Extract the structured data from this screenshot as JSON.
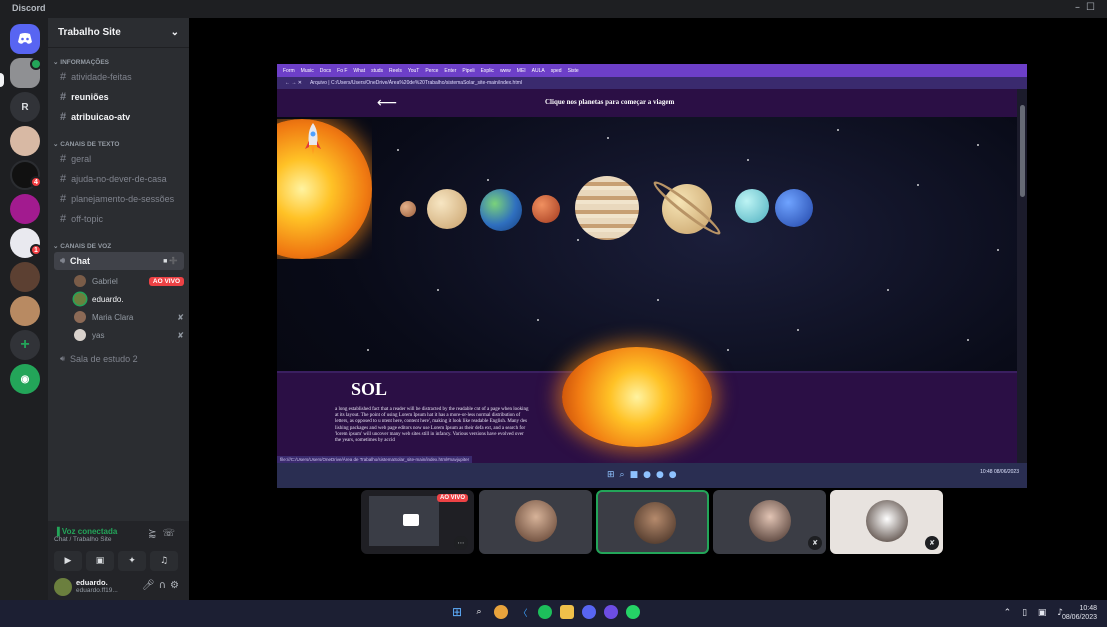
{
  "app": {
    "title": "Discord"
  },
  "rail": {
    "badge1": "4",
    "badge2": "1",
    "server_r": "R",
    "add_icon": "plus-icon",
    "explore_icon": "compass-icon"
  },
  "sidebar": {
    "server_name": "Trabalho Site",
    "cat_info": "INFORMAÇÕES",
    "info_channels": [
      "atividade-feitas",
      "reuniões",
      "atribuicao-atv"
    ],
    "cat_text": "CANAIS DE TEXTO",
    "text_channels": [
      "geral",
      "ajuda-no-dever-de-casa",
      "planejamento-de-sessões",
      "off-topic"
    ],
    "cat_voice": "CANAIS DE VOZ",
    "voice_channel": "Chat",
    "voice_users": [
      {
        "name": "Gabriel",
        "live": "AO VIVO"
      },
      {
        "name": "eduardo."
      },
      {
        "name": "Maria Clara"
      },
      {
        "name": "yas"
      }
    ],
    "voice_channel2": "Sala de estudo 2"
  },
  "voice_panel": {
    "status": "Voz conectada",
    "location": "Chat / Trabalho Site"
  },
  "user_panel": {
    "name": "eduardo.",
    "tag": "eduardo.ff19..."
  },
  "browser": {
    "tabs": [
      "Form",
      "Music",
      "Docs",
      "Fo F",
      "What",
      "studs",
      "Reels",
      "YouT",
      "Perce",
      "Enter",
      "Pipeli",
      "Explic",
      "www",
      "MEI",
      "AULA",
      "sped",
      "Siste"
    ],
    "address": "Arquivo  |  C:/Users/Users/OneDrive/Área%20de%20Trabalho/sistemaSolar_site-main/index.html",
    "hint": "Clique nos planetas para começar a viagem",
    "sol_title": "SOL",
    "sol_text": "a long established fact that a reader will be distracted by the readable cnt of a page when looking at its layout. The point of using Lorem Ipsum hat it has a more-or-less normal distribution of letters, as opposed to u ntent here, content here', making it look like readable English. Many des lishing packages and web page editors now use Lorem Ipsum as their defa ext, and a search for 'lorem ipsum' will uncover many web sites still in infancy. Various versions have evolved over the years, sometimes by accid",
    "status_url": "file:///C:/Users/Users/OneDrive/Área de Trabalho/sistemaSolar_site-main/index.html#navjupiter",
    "inner_clock": "10:48",
    "inner_date": "08/06/2023"
  },
  "tiles": {
    "live": "AO VIVO"
  },
  "taskbar": {
    "time": "10:48",
    "date": "08/06/2023"
  }
}
